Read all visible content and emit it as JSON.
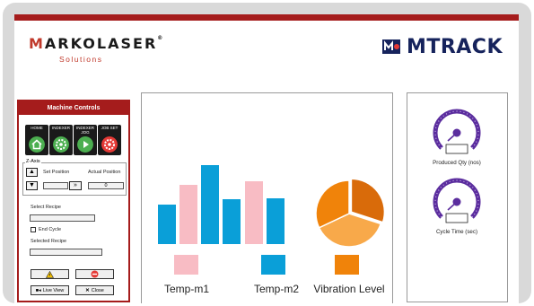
{
  "header": {
    "brand_left": "MARKOLASER",
    "brand_left_sub": "Solutions",
    "brand_left_reg": "®",
    "brand_right": "MTRACK"
  },
  "machine_controls": {
    "title": "Machine Controls",
    "buttons": [
      {
        "label": "HOME",
        "icon": "home-icon",
        "color": "#4caf50"
      },
      {
        "label": "INDEXER",
        "icon": "gear-icon",
        "color": "#4caf50"
      },
      {
        "label": "INDEXER JOG",
        "icon": "play-icon",
        "color": "#4caf50"
      },
      {
        "label": "JOB SET",
        "icon": "settings-icon",
        "color": "#e53935"
      }
    ],
    "z_axis": {
      "label": "Z-Axis",
      "set_position_label": "Set Position",
      "actual_position_label": "Actual Position",
      "set_position_value": "",
      "actual_position_value": "0"
    },
    "select_recipe_label": "Select Recipe",
    "select_recipe_value": "",
    "end_cycle_label": "End Cycle",
    "selected_recipe_label": "Selected Recipe",
    "selected_recipe_value": "",
    "live_view_label": "Live View",
    "close_label": "Close"
  },
  "chart": {
    "legend": [
      {
        "name": "Temp-m1",
        "color": "#f8bcc4"
      },
      {
        "name": "Temp-m2",
        "color": "#0a9fd8"
      },
      {
        "name": "Vibration Level",
        "color": "#f0830a"
      }
    ]
  },
  "chart_data": {
    "type": "bar",
    "colors": [
      "#0a9fd8",
      "#f8bcc4",
      "#0a9fd8",
      "#0a9fd8",
      "#f8bcc4",
      "#0a9fd8"
    ],
    "values": [
      44,
      66,
      88,
      50,
      70,
      51
    ],
    "pie": {
      "values": [
        30,
        38,
        32
      ],
      "colors": [
        "#d96b0a",
        "#f8a94a",
        "#f0830a"
      ]
    }
  },
  "gauges": [
    {
      "label": "Produced Qty (nos)",
      "value": ""
    },
    {
      "label": "Cycle Time (sec)",
      "value": ""
    }
  ],
  "colors": {
    "accent": "#a51c1c",
    "gauge_arc": "#5b2d9e",
    "brand_blue": "#16235c"
  }
}
